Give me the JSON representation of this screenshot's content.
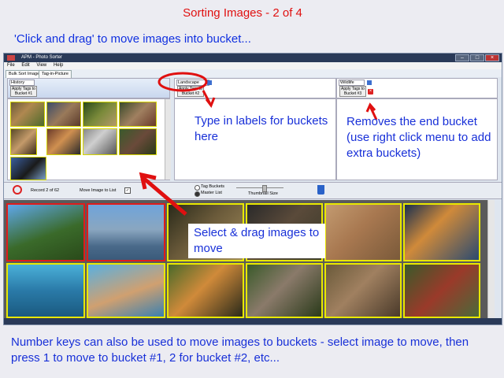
{
  "header": {
    "title": "Sorting Images  -  2 of 4",
    "subtitle": "'Click and drag' to move images into bucket..."
  },
  "window": {
    "title": "APM - Photo Sorter",
    "menu": [
      "File",
      "Edit",
      "View",
      "Help"
    ],
    "tabs": [
      "Bulk Sort Images",
      "Tag-in-Picture"
    ]
  },
  "buckets": [
    {
      "label": "History",
      "button": "Apply Tags to Bucket #1"
    },
    {
      "label": "Landscape",
      "button": "Apply Tags to Bucket #2"
    },
    {
      "label": "Wildlife",
      "button": "Apply Tags to Bucket #3"
    }
  ],
  "toolbar": {
    "record": "Record 2 of 62",
    "move_label": "Move Image to List",
    "radio1": "Tag Buckets",
    "radio2": "Master List",
    "thumb_size": "Thumbnail Size"
  },
  "notes": {
    "labels": "Type in labels for buckets here",
    "remove": "Removes the end bucket (use right click menu to add extra buckets)",
    "drag": "Select & drag images to move",
    "bottom": "Number keys can also be used to move images to buckets - select image to move, then press 1 to move to bucket #1, 2 for bucket #2, etc..."
  },
  "colors": {
    "accent_red": "#e01010",
    "note_blue": "#1830d8",
    "thumb_border": "#e8e800",
    "selected_border": "#e01b1b"
  }
}
